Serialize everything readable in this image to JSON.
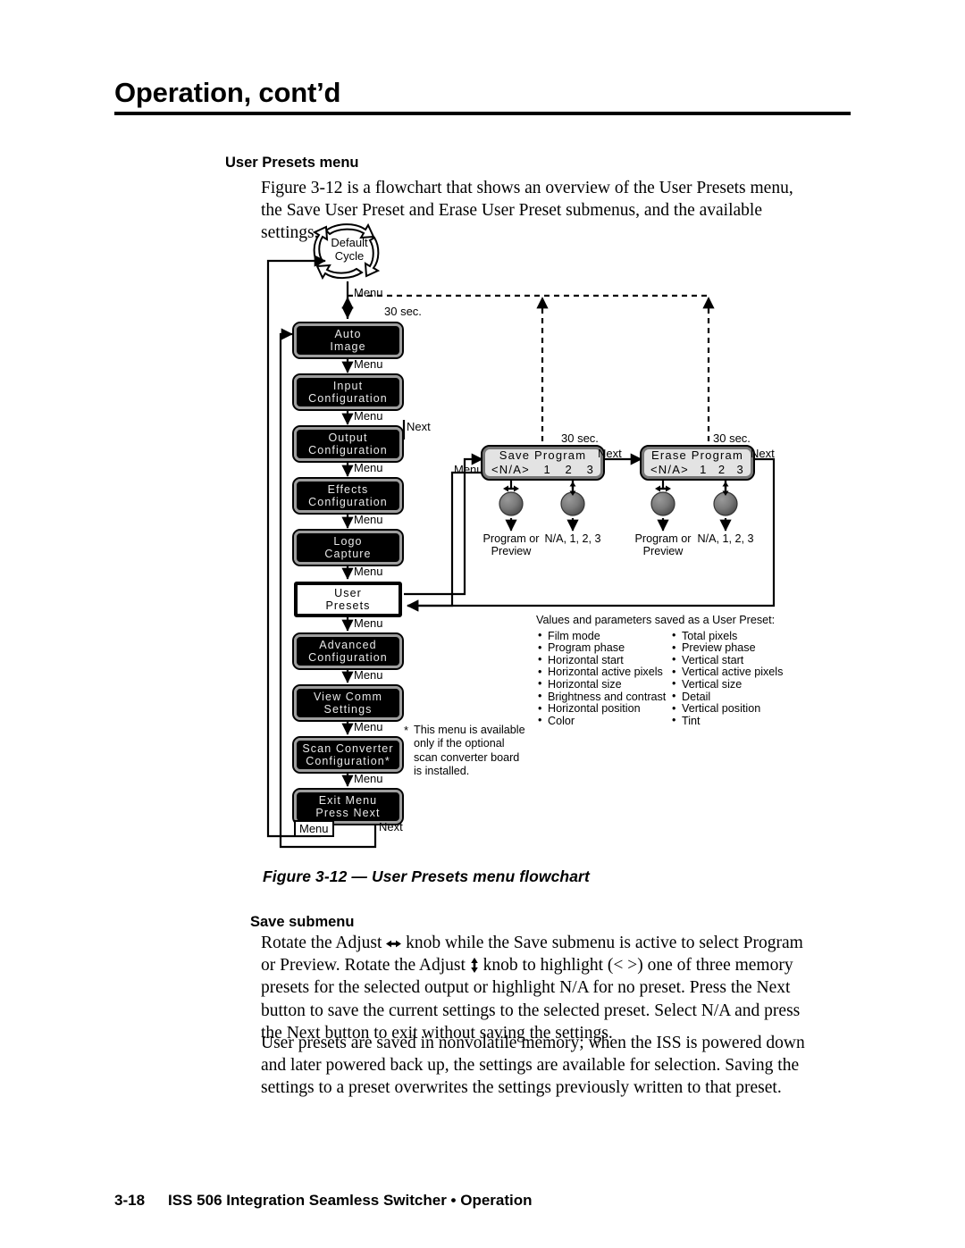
{
  "header": {
    "title": "Operation, cont’d"
  },
  "section": {
    "heading": "User Presets menu",
    "intro": "Figure 3-12 is a flowchart that shows an overview of the User Presets menu, the Save User Preset and Erase User Preset submenus, and the available settings."
  },
  "figure": {
    "caption": "Figure 3-12 — User Presets menu flowchart",
    "default_cycle": {
      "line1": "Default",
      "line2": "Cycle"
    },
    "menu_boxes": [
      {
        "line1": "Auto",
        "line2": "Image",
        "selected": false
      },
      {
        "line1": "Input",
        "line2": "Configuration",
        "selected": false
      },
      {
        "line1": "Output",
        "line2": "Configuration",
        "selected": false
      },
      {
        "line1": "Effects",
        "line2": "Configuration",
        "selected": false
      },
      {
        "line1": "Logo",
        "line2": "Capture",
        "selected": false
      },
      {
        "line1": "User",
        "line2": "Presets",
        "selected": true
      },
      {
        "line1": "Advanced",
        "line2": "Configuration",
        "selected": false
      },
      {
        "line1": "View Comm",
        "line2": "Settings",
        "selected": false
      },
      {
        "line1": "Scan Converter",
        "line2": "Configuration*",
        "selected": false
      },
      {
        "line1": "Exit Menu",
        "line2": "Press Next",
        "selected": false
      }
    ],
    "menu_link_label": "Menu",
    "next_label": "Next",
    "timeout_label": "30 sec.",
    "lcd_boxes": [
      {
        "title": "Save Program",
        "cells": [
          "<N/A>",
          "1",
          "2",
          "3"
        ],
        "knob_left_result": {
          "line1": "Program or",
          "line2": "Preview"
        },
        "knob_right_result": "N/A, 1, 2, 3"
      },
      {
        "title": "Erase Program",
        "cells": [
          "<N/A>",
          "1",
          "2",
          "3"
        ],
        "knob_left_result": {
          "line1": "Program or",
          "line2": "Preview"
        },
        "knob_right_result": "N/A, 1, 2, 3"
      }
    ],
    "values_note": {
      "title": "Values and parameters saved as a User Preset:",
      "col1": [
        "Film mode",
        "Program phase",
        "Horizontal start",
        "Horizontal active pixels",
        "Horizontal size",
        "Brightness and contrast",
        "Horizontal position",
        "Color"
      ],
      "col2": [
        "Total pixels",
        "Preview phase",
        "Vertical start",
        "Vertical active pixels",
        "Vertical size",
        "Detail",
        "Vertical position",
        "Tint"
      ]
    },
    "scan_note": {
      "marker": "*",
      "text": "This menu is available only if the optional scan converter board is installed."
    }
  },
  "save_submenu": {
    "heading": "Save submenu",
    "para1_a": "Rotate the Adjust ",
    "para1_b": " knob while the Save submenu is active to select Program or Preview.  Rotate the Adjust ",
    "para1_c": " knob to highlight (< >) one of three memory presets for the selected output or highlight N/A for no preset.  Press the Next button to save the current settings to the selected preset.  Select N/A and press the Next button to exit without saving the settings.",
    "para2": "User presets are saved in nonvolatile memory; when the ISS is powered down and later powered back up, the settings are available for selection.  Saving the settings to a preset overwrites the settings previously written to that preset."
  },
  "footer": {
    "page_number": "3-18",
    "text": "ISS 506 Integration Seamless Switcher • Operation"
  }
}
